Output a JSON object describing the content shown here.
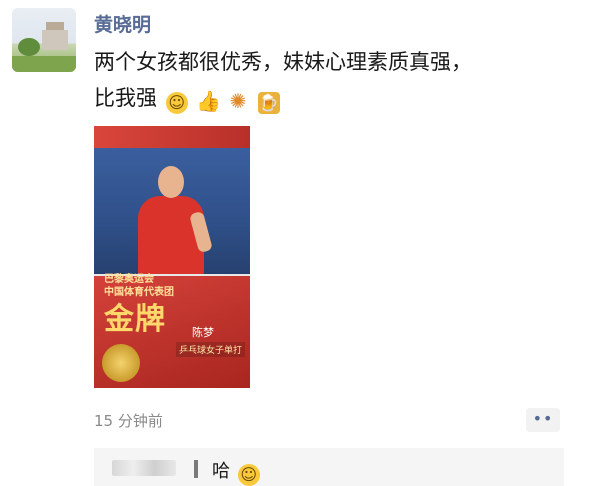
{
  "post": {
    "username": "黄晓明",
    "text_line1": "两个女孩都很优秀，妹妹心理素质真强，",
    "text_line2": "比我强",
    "emojis": [
      "grin-emoji",
      "thumbs-up-emoji",
      "firework-emoji",
      "beer-emoji"
    ],
    "timestamp": "15 分钟前",
    "more_label": "••"
  },
  "image_card": {
    "small_line1": "巴黎奥运会",
    "small_line2": "中国体育代表团",
    "headline": "金牌",
    "athlete_name": "陈梦",
    "event": "乒乓球女子单打"
  },
  "comment": {
    "text": "哈"
  },
  "colors": {
    "username": "#576b95",
    "timestamp": "#8a8a8a",
    "card_red": "#c23a2f",
    "gold": "#ffd86b"
  }
}
